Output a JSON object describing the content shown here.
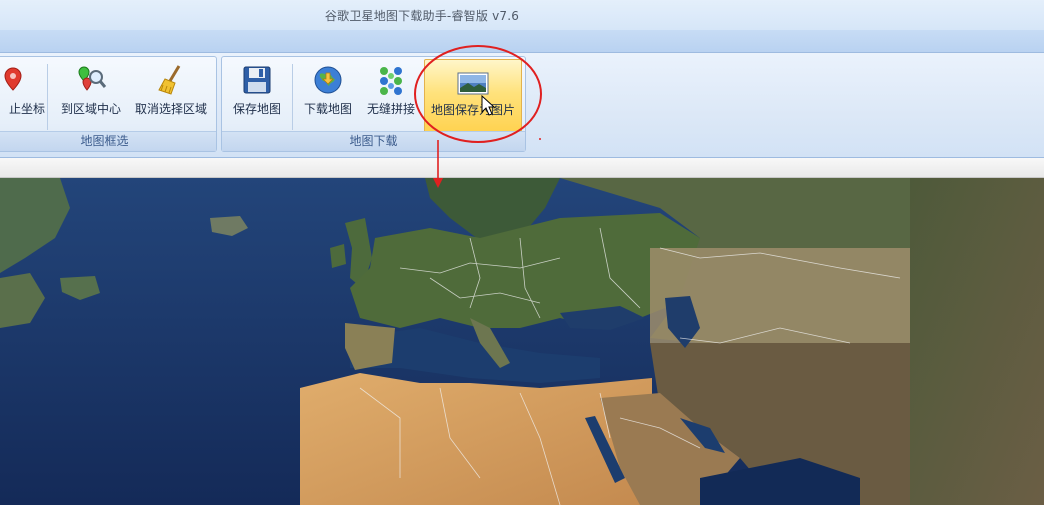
{
  "window": {
    "title": "谷歌卫星地图下载助手-睿智版 v7.6"
  },
  "ribbon": {
    "groups": [
      {
        "label": "地图框选",
        "buttons": [
          {
            "label": "止坐标",
            "icon": "map-pin-icon"
          },
          {
            "label": "到区域中心",
            "icon": "pin-search-icon"
          },
          {
            "label": "取消选择区域",
            "icon": "broom-icon"
          }
        ]
      },
      {
        "label": "地图下载",
        "buttons": [
          {
            "label": "保存地图",
            "icon": "save-disk-icon"
          },
          {
            "label": "下载地图",
            "icon": "globe-download-icon"
          },
          {
            "label": "无缝拼接",
            "icon": "stitch-dots-icon"
          },
          {
            "label": "地图保存为图片",
            "icon": "image-icon",
            "highlighted": true
          }
        ]
      }
    ]
  },
  "colors": {
    "annotation_red": "#e02020",
    "highlight_gold": "#ffd24f",
    "ocean": "#23457a",
    "desert": "#d4a062"
  }
}
